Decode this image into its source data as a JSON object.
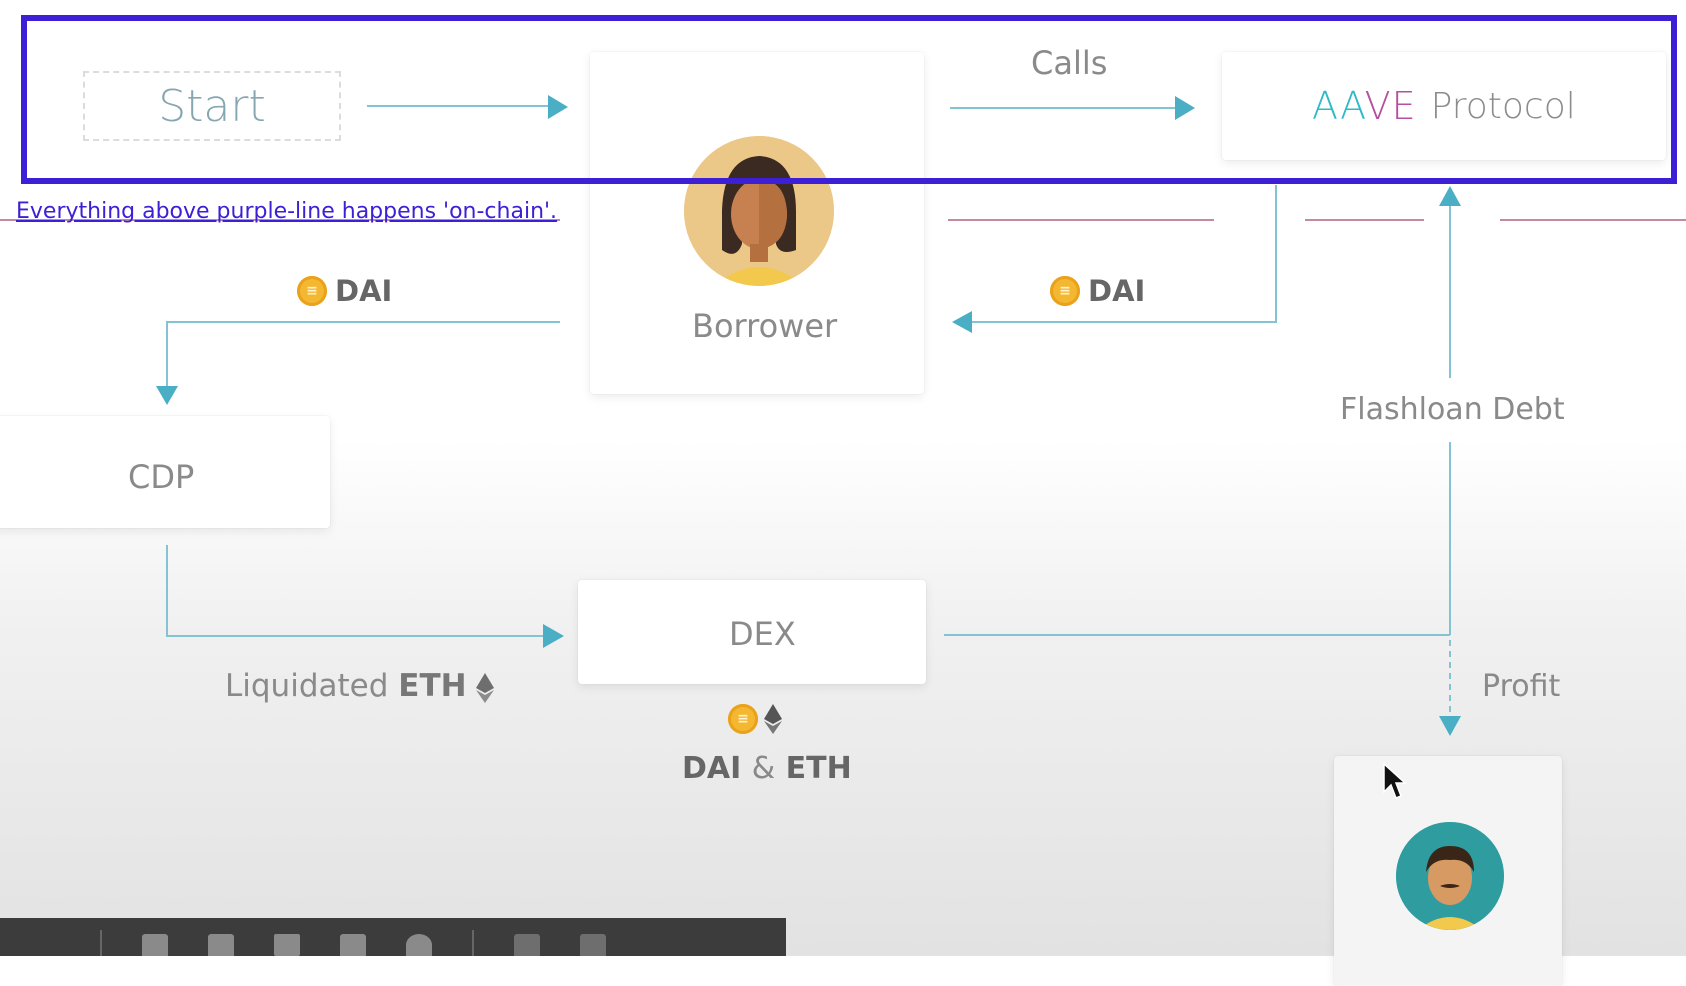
{
  "diagram": {
    "start_label": "Start",
    "calls_label": "Calls",
    "aave_wordmark": "AAVE",
    "protocol_label": "Protocol",
    "borrower_label": "Borrower",
    "dai_left_label": "DAI",
    "dai_right_label": "DAI",
    "cdp_label": "CDP",
    "dex_label": "DEX",
    "liquidated_prefix": "Liquidated",
    "liquidated_token": "ETH",
    "flashloan_debt_label": "Flashloan Debt",
    "profit_label": "Profit",
    "dex_output_dai": "DAI",
    "dex_output_amp": "&",
    "dex_output_eth": "ETH"
  },
  "annotation": {
    "note": "Everything above purple-line happens 'on-chain'.",
    "frame_color": "#3d1fd6"
  },
  "colors": {
    "wire": "#84c3d2",
    "arrow": "#4aaec4",
    "chain_line": "#b97593",
    "dai_coin": "#f4b731"
  }
}
